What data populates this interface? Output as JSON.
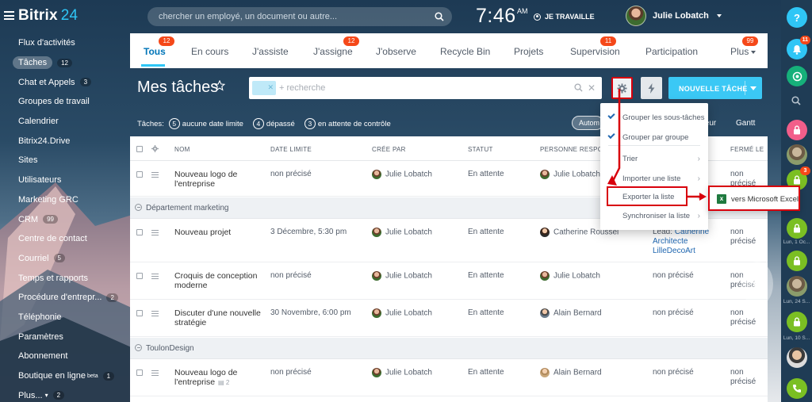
{
  "app": {
    "logo_text": "Bitrix",
    "logo_num": "24"
  },
  "header": {
    "search_placeholder": "chercher un employé, un document ou autre...",
    "time": "7:46",
    "ampm": "AM",
    "work_status": "JE TRAVAILLE",
    "user_name": "Julie Lobatch"
  },
  "leftmenu": {
    "items": [
      {
        "label": "Flux d'activités"
      },
      {
        "label": "Tâches",
        "count": "12",
        "active": true
      },
      {
        "label": "Chat et Appels",
        "count": "3"
      },
      {
        "label": "Groupes de travail"
      },
      {
        "label": "Calendrier"
      },
      {
        "label": "Bitrix24.Drive"
      },
      {
        "label": "Sites"
      },
      {
        "label": "Utilisateurs"
      },
      {
        "label": "Marketing GRC"
      },
      {
        "label": "CRM",
        "count": "99"
      },
      {
        "label": "Centre de contact"
      },
      {
        "label": "Courriel",
        "count": "5"
      },
      {
        "label": "Temps et rapports"
      },
      {
        "label": "Procédure d'entrepr...",
        "count": "2"
      },
      {
        "label": "Téléphonie"
      },
      {
        "label": "Paramètres"
      },
      {
        "label": "Abonnement"
      },
      {
        "label": "Boutique en ligne",
        "sup": "beta",
        "count": "1"
      },
      {
        "label": "Plus...",
        "caret": "▾",
        "count": "2"
      }
    ]
  },
  "tabs": [
    {
      "label": "Tous",
      "badge": "12",
      "active": true
    },
    {
      "label": "En cours"
    },
    {
      "label": "J'assiste"
    },
    {
      "label": "J'assigne",
      "badge": "12"
    },
    {
      "label": "J'observe"
    },
    {
      "label": "Recycle Bin"
    },
    {
      "label": "Projets"
    },
    {
      "label": "Supervision",
      "badge": "11"
    },
    {
      "label": "Participation"
    },
    {
      "label": "Plus",
      "badge": "99",
      "caret": true
    }
  ],
  "toolbar": {
    "page_title": "Mes tâches",
    "filter_placeholder": "+ recherche",
    "new_task": "NOUVELLE TÂCHE"
  },
  "counters": {
    "prefix": "Tâches:",
    "items": [
      {
        "num": "5",
        "label": "aucune date limite"
      },
      {
        "num": "4",
        "label": "dépassé"
      },
      {
        "num": "3",
        "label": "en attente de contrôle"
      }
    ],
    "auto_label": "Autom",
    "view_tail": "teur",
    "gantt": "Gantt"
  },
  "grid": {
    "headers": {
      "name": "NOM",
      "deadline": "DATE LIMITE",
      "created_by": "CRÉE PAR",
      "status": "STATUT",
      "responsible": "PERSONNE RESPONS",
      "closed": "FERMÉ LE"
    },
    "groups": [
      "Département marketing",
      "ToulonDesign"
    ],
    "rows": [
      {
        "name": "Nouveau logo de l'entreprise",
        "deadline": "non précisé",
        "creator": "Julie Lobatch",
        "status": "En attente",
        "resp": "Julie Lobatch",
        "col6": "",
        "closed": "non précisé"
      },
      {
        "name": "Nouveau projet",
        "deadline": "3 Décembre, 5:30 pm",
        "creator": "Julie Lobatch",
        "status": "En attente",
        "resp": "Catherine Roussel",
        "col6_prefix": "Lead:",
        "col6_link": "Catherine Architecte LilleDecoArt",
        "closed": "non précisé"
      },
      {
        "name": "Croquis de conception moderne",
        "deadline": "non précisé",
        "creator": "Julie Lobatch",
        "status": "En attente",
        "resp": "Julie Lobatch",
        "col6": "non précisé",
        "closed": "non précisé"
      },
      {
        "name": "Discuter d'une nouvelle stratégie",
        "deadline": "30 Novembre, 6:00 pm",
        "creator": "Julie Lobatch",
        "status": "En attente",
        "resp": "Alain Bernard",
        "col6": "non précisé",
        "closed": "non précisé"
      },
      {
        "name": "Nouveau logo de l'entreprise",
        "subcount": "2",
        "deadline": "non précisé",
        "creator": "Julie Lobatch",
        "status": "En attente",
        "resp": "Alain Bernard",
        "col6": "non précisé",
        "closed": "non précisé"
      }
    ]
  },
  "popup": {
    "items": [
      {
        "label": "Grouper les sous-tâches",
        "checked": true
      },
      {
        "label": "Grouper par groupe",
        "checked": true
      },
      {
        "label": "Trier",
        "arrow": "›"
      },
      {
        "label": "Importer une liste",
        "arrow": "›"
      },
      {
        "label": "Exporter la liste",
        "arrow": "›"
      },
      {
        "label": "Synchroniser la liste",
        "arrow": "›"
      }
    ],
    "sub_item": "vers Microsoft Excel"
  },
  "rightbar": {
    "help": "?",
    "bell_badge": "11",
    "lock_badge": "3",
    "times": [
      "Lun, 1 Oc...",
      "Lun, 24 S...",
      "Lun, 10 S..."
    ]
  }
}
